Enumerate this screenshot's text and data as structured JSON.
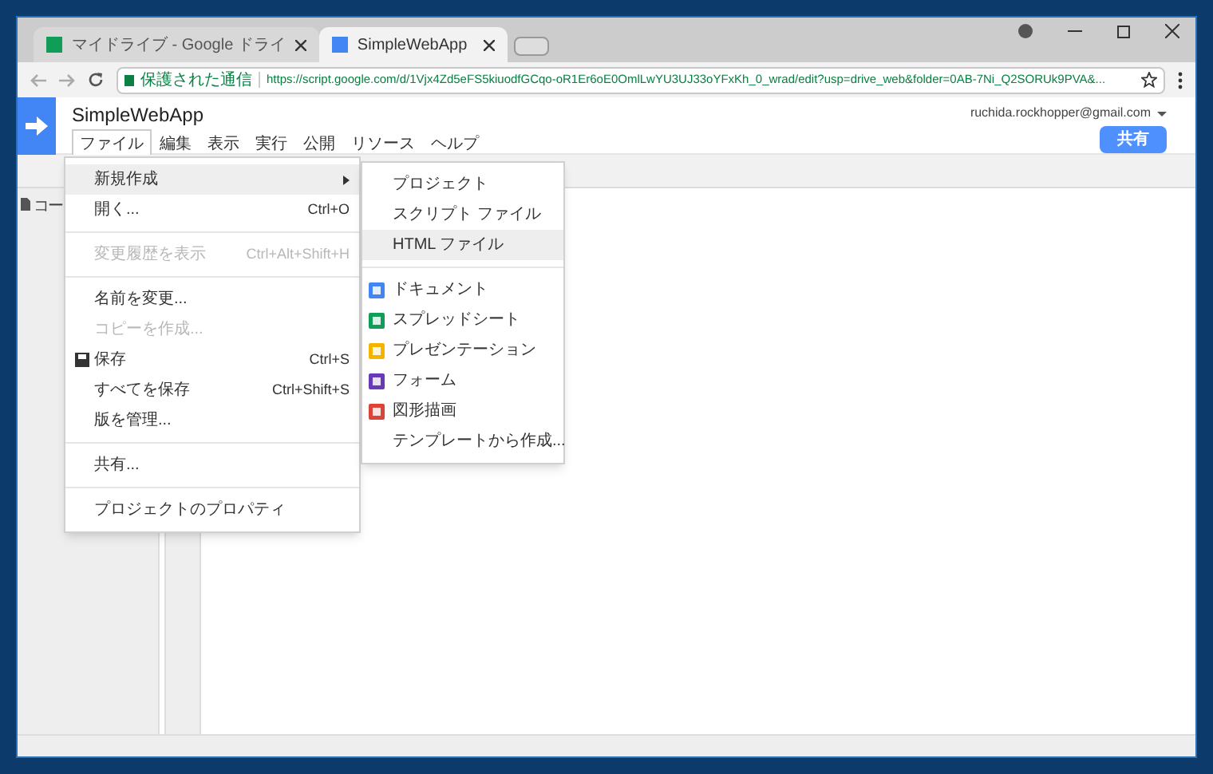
{
  "browser": {
    "tabs": [
      {
        "title": "マイドライブ - Google ドライ",
        "selected": false
      },
      {
        "title": "SimpleWebApp",
        "selected": true
      }
    ],
    "secure_label": "保護された通信",
    "url": "https://script.google.com/d/1Vjx4Zd5eFS5kiuodfGCqo-oR1Er6oE0OmlLwYU3UJ33oYFxKh_0_wrad/edit?usp=drive_web&folder=0AB-7Ni_Q2SORUk9PVA&..."
  },
  "app": {
    "title": "SimpleWebApp",
    "account": "ruchida.rockhopper@gmail.com",
    "share_button": "共有",
    "menu": [
      {
        "label": "ファイル",
        "selected": true
      },
      {
        "label": "編集",
        "selected": false
      },
      {
        "label": "表示",
        "selected": false
      },
      {
        "label": "実行",
        "selected": false
      },
      {
        "label": "公開",
        "selected": false
      },
      {
        "label": "リソース",
        "selected": false
      },
      {
        "label": "ヘルプ",
        "selected": false
      }
    ]
  },
  "sidebar": {
    "label": "コー"
  },
  "file_menu": [
    {
      "kind": "item",
      "label": "新規作成",
      "submenu": true,
      "selected": true,
      "disabled": false
    },
    {
      "kind": "item",
      "label": "開く...",
      "shortcut": "Ctrl+O",
      "selected": false,
      "disabled": false
    },
    {
      "kind": "separator"
    },
    {
      "kind": "item",
      "label": "変更履歴を表示",
      "shortcut": "Ctrl+Alt+Shift+H",
      "selected": false,
      "disabled": true
    },
    {
      "kind": "separator"
    },
    {
      "kind": "item",
      "label": "名前を変更...",
      "selected": false,
      "disabled": false
    },
    {
      "kind": "item",
      "label": "コピーを作成...",
      "selected": false,
      "disabled": true
    },
    {
      "kind": "item",
      "label": "保存",
      "shortcut": "Ctrl+S",
      "icon": true,
      "selected": false,
      "disabled": false
    },
    {
      "kind": "item",
      "label": "すべてを保存",
      "shortcut": "Ctrl+Shift+S",
      "selected": false,
      "disabled": false
    },
    {
      "kind": "item",
      "label": "版を管理...",
      "selected": false,
      "disabled": false
    },
    {
      "kind": "separator"
    },
    {
      "kind": "item",
      "label": "共有...",
      "selected": false,
      "disabled": false
    },
    {
      "kind": "separator"
    },
    {
      "kind": "item",
      "label": "プロジェクトのプロパティ",
      "selected": false,
      "disabled": false
    }
  ],
  "new_submenu": [
    {
      "kind": "item",
      "label": "プロジェクト",
      "selected": false
    },
    {
      "kind": "item",
      "label": "スクリプト ファイル",
      "selected": false
    },
    {
      "kind": "item",
      "label": "HTML ファイル",
      "selected": true
    },
    {
      "kind": "separator"
    },
    {
      "kind": "item",
      "label": "ドキュメント",
      "color": "#4285f4",
      "selected": false
    },
    {
      "kind": "item",
      "label": "スプレッドシート",
      "color": "#0f9d58",
      "selected": false
    },
    {
      "kind": "item",
      "label": "プレゼンテーション",
      "color": "#f4b400",
      "selected": false
    },
    {
      "kind": "item",
      "label": "フォーム",
      "color": "#673ab7",
      "selected": false
    },
    {
      "kind": "item",
      "label": "図形描画",
      "color": "#db4437",
      "selected": false
    },
    {
      "kind": "item",
      "label": "テンプレートから作成...",
      "selected": false
    }
  ]
}
